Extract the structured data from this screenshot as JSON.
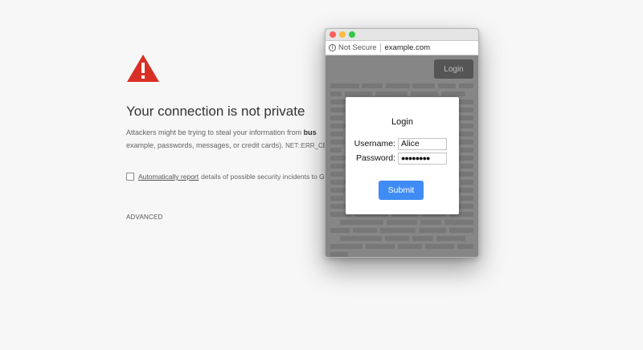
{
  "error_page": {
    "title": "Your connection is not private",
    "description_prefix": "Attackers might be trying to steal your information from",
    "description_bold": "bus",
    "description_line2": "example, passwords, messages, or credit cards).",
    "error_code": "NET::ERR_CER",
    "report_link": "Automatically report",
    "report_text": "details of possible security incidents to Goo",
    "advanced_label": "ADVANCED",
    "warning_icon": "warning-triangle-icon",
    "warning_color": "#d93025"
  },
  "popup_window": {
    "security_label": "Not Secure",
    "domain": "example.com",
    "header_login_label": "Login",
    "dialog": {
      "title": "Login",
      "username_label": "Username:",
      "username_value": "Alice",
      "password_label": "Password:",
      "password_value": "●●●●●●●●",
      "submit_label": "Submit",
      "submit_color": "#3f8cf4"
    }
  }
}
